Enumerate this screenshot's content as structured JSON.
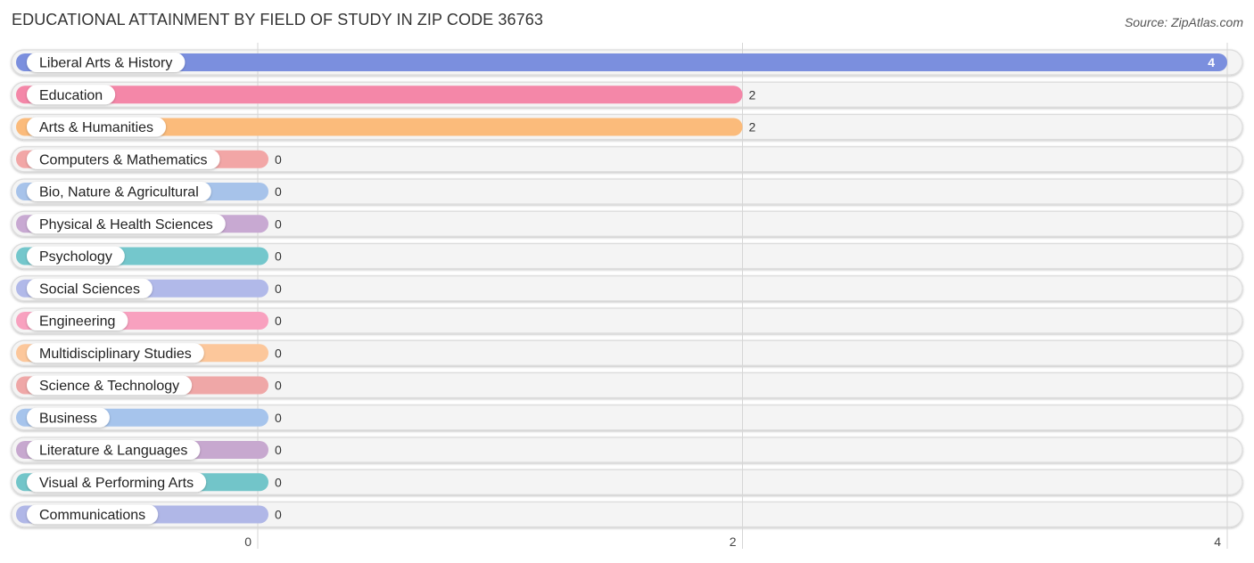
{
  "header": {
    "title": "EDUCATIONAL ATTAINMENT BY FIELD OF STUDY IN ZIP CODE 36763",
    "source": "Source: ZipAtlas.com"
  },
  "chart_data": {
    "type": "bar",
    "orientation": "horizontal",
    "title": "EDUCATIONAL ATTAINMENT BY FIELD OF STUDY IN ZIP CODE 36763",
    "xlabel": "",
    "ylabel": "",
    "xlim": [
      0,
      4
    ],
    "xticks": [
      0,
      2,
      4
    ],
    "grid": true,
    "categories": [
      "Liberal Arts & History",
      "Education",
      "Arts & Humanities",
      "Computers & Mathematics",
      "Bio, Nature & Agricultural",
      "Physical & Health Sciences",
      "Psychology",
      "Social Sciences",
      "Engineering",
      "Multidisciplinary Studies",
      "Science & Technology",
      "Business",
      "Literature & Languages",
      "Visual & Performing Arts",
      "Communications"
    ],
    "values": [
      4,
      2,
      2,
      0,
      0,
      0,
      0,
      0,
      0,
      0,
      0,
      0,
      0,
      0,
      0
    ],
    "colors": [
      "#7b8fde",
      "#f487a8",
      "#fbbb7b",
      "#f2a6a6",
      "#a7c3ea",
      "#c8a9d2",
      "#74c7cc",
      "#b1b9e9",
      "#f8a1bf",
      "#fcc79b",
      "#efa7a7",
      "#a6c4ec",
      "#c7a8cf",
      "#72c5c9",
      "#b0b7e7"
    ]
  }
}
